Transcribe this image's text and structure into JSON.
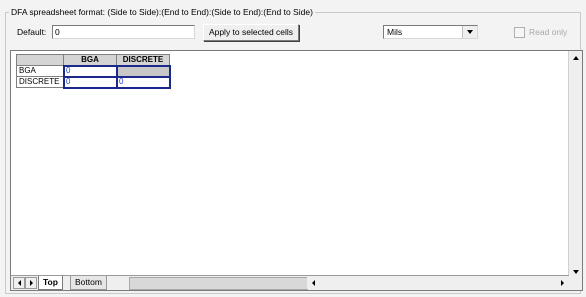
{
  "group": {
    "caption": "DFA spreadsheet format:  (Side to Side):(End to End):(Side to End):(End to Side)"
  },
  "default_field": {
    "label": "Default:",
    "value": "0"
  },
  "apply_button": {
    "label": "Apply to selected cells"
  },
  "units_select": {
    "selected": "Mils"
  },
  "readonly_checkbox": {
    "label": "Read only",
    "checked": false
  },
  "sheet": {
    "columns": [
      "BGA",
      "DISCRETE"
    ],
    "rows": [
      {
        "label": "BGA",
        "cells": [
          "0",
          ""
        ]
      },
      {
        "label": "DISCRETE",
        "cells": [
          "0",
          "0"
        ]
      }
    ]
  },
  "tabs": [
    {
      "label": "Top",
      "active": true
    },
    {
      "label": "Bottom",
      "active": false
    }
  ],
  "colors": {
    "cell_text": "#1e3fc8",
    "selection_outline": "#1b2a8a",
    "disabled_text": "#a8a8a8"
  }
}
